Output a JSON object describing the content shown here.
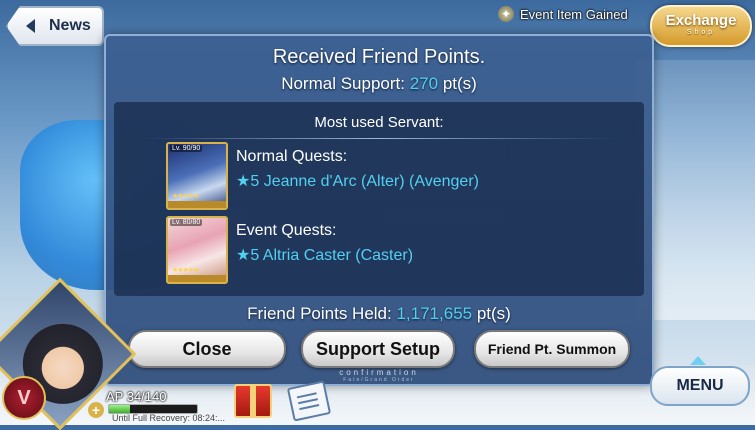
{
  "header": {
    "news_label": "News",
    "event_item_text": "Event Item Gained",
    "exchange_label": "Exchange",
    "exchange_sub": "Shop"
  },
  "dialog": {
    "title": "Received Friend Points.",
    "normal_support_label": "Normal Support:",
    "normal_support_value": "270",
    "normal_support_unit": "pt(s)",
    "panel_title": "Most used Servant:",
    "servants": [
      {
        "quest_label": "Normal Quests:",
        "name": "★5  Jeanne d'Arc (Alter) (Avenger)",
        "level": "Lv. 90/90",
        "stars": "★★★★★"
      },
      {
        "quest_label": "Event Quests:",
        "name": "★5  Altria Caster (Caster)",
        "level": "Lv. 80/80",
        "stars": "★★★★★"
      }
    ],
    "friend_held_label": "Friend Points Held:",
    "friend_held_value": "1,171,655",
    "friend_held_unit": "pt(s)",
    "close_label": "Close",
    "support_setup_label": "Support Setup",
    "friend_summon_label": "Friend Pt. Summon",
    "confirmation_text": "confirmation",
    "fgo_text": "Fate/Grand Order"
  },
  "menu_label": "MENU",
  "player": {
    "class_emblem": "V",
    "ap_text": "AP 34/140",
    "ap_fraction": 0.243,
    "recovery_text": "Until Full Recovery: 08:24:..."
  },
  "colors": {
    "accent_cyan": "#52d0f0",
    "dialog_bg": "#3c5f91",
    "gold": "#d9b34a"
  },
  "icons": {
    "news": "chevron-left-icon",
    "event": "star-icon",
    "gift": "gift-icon",
    "mission": "document-icon",
    "menu": "chevron-up-icon"
  }
}
